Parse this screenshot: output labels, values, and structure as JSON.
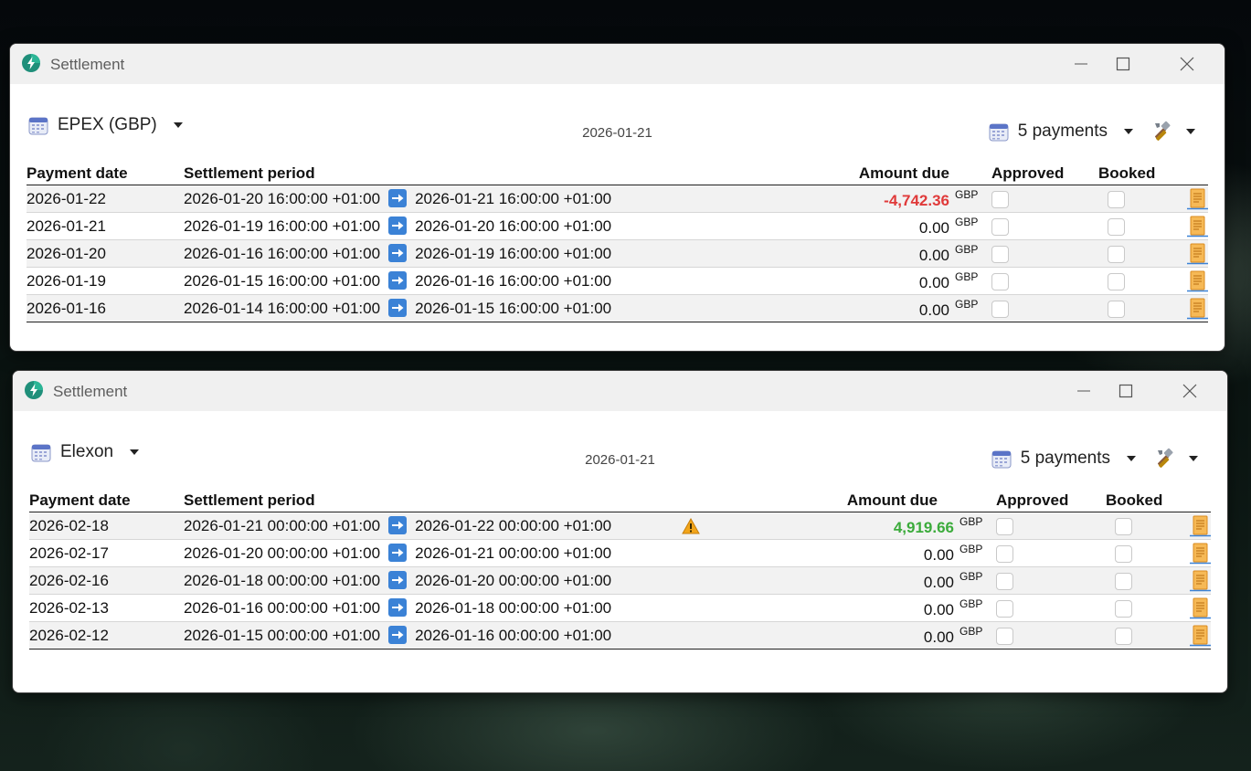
{
  "windows": [
    {
      "title": "Settlement",
      "source_label": "EPEX (GBP)",
      "date": "2026-01-21",
      "payments_label": "5 payments",
      "columns": {
        "payment_date": "Payment date",
        "settlement_period": "Settlement period",
        "amount_due": "Amount due",
        "approved": "Approved",
        "booked": "Booked"
      },
      "rows": [
        {
          "payment_date": "2026-01-22",
          "period_start": "2026-01-20 16:00:00 +01:00",
          "period_end": "2026-01-21 16:00:00 +01:00",
          "amount": "-4,742.36",
          "currency": "GBP",
          "amount_style": "neg",
          "warning": false
        },
        {
          "payment_date": "2026-01-21",
          "period_start": "2026-01-19 16:00:00 +01:00",
          "period_end": "2026-01-20 16:00:00 +01:00",
          "amount": "0.00",
          "currency": "GBP",
          "amount_style": "",
          "warning": false
        },
        {
          "payment_date": "2026-01-20",
          "period_start": "2026-01-16 16:00:00 +01:00",
          "period_end": "2026-01-19 16:00:00 +01:00",
          "amount": "0.00",
          "currency": "GBP",
          "amount_style": "",
          "warning": false
        },
        {
          "payment_date": "2026-01-19",
          "period_start": "2026-01-15 16:00:00 +01:00",
          "period_end": "2026-01-16 16:00:00 +01:00",
          "amount": "0.00",
          "currency": "GBP",
          "amount_style": "",
          "warning": false
        },
        {
          "payment_date": "2026-01-16",
          "period_start": "2026-01-14 16:00:00 +01:00",
          "period_end": "2026-01-15 16:00:00 +01:00",
          "amount": "0.00",
          "currency": "GBP",
          "amount_style": "",
          "warning": false
        }
      ]
    },
    {
      "title": "Settlement",
      "source_label": "Elexon",
      "date": "2026-01-21",
      "payments_label": "5 payments",
      "columns": {
        "payment_date": "Payment date",
        "settlement_period": "Settlement period",
        "amount_due": "Amount due",
        "approved": "Approved",
        "booked": "Booked"
      },
      "rows": [
        {
          "payment_date": "2026-02-18",
          "period_start": "2026-01-21 00:00:00 +01:00",
          "period_end": "2026-01-22 00:00:00 +01:00",
          "amount": "4,919.66",
          "currency": "GBP",
          "amount_style": "pos",
          "warning": true
        },
        {
          "payment_date": "2026-02-17",
          "period_start": "2026-01-20 00:00:00 +01:00",
          "period_end": "2026-01-21 00:00:00 +01:00",
          "amount": "0.00",
          "currency": "GBP",
          "amount_style": "",
          "warning": false
        },
        {
          "payment_date": "2026-02-16",
          "period_start": "2026-01-18 00:00:00 +01:00",
          "period_end": "2026-01-20 00:00:00 +01:00",
          "amount": "0.00",
          "currency": "GBP",
          "amount_style": "",
          "warning": false
        },
        {
          "payment_date": "2026-02-13",
          "period_start": "2026-01-16 00:00:00 +01:00",
          "period_end": "2026-01-18 00:00:00 +01:00",
          "amount": "0.00",
          "currency": "GBP",
          "amount_style": "",
          "warning": false
        },
        {
          "payment_date": "2026-02-12",
          "period_start": "2026-01-15 00:00:00 +01:00",
          "period_end": "2026-01-16 00:00:00 +01:00",
          "amount": "0.00",
          "currency": "GBP",
          "amount_style": "",
          "warning": false
        }
      ]
    }
  ],
  "icons": {
    "app": "app-logo-icon",
    "calendar": "calendar-icon",
    "arrow": "right-arrow-icon",
    "tools": "tools-icon",
    "document": "document-icon",
    "warning": "warning-icon"
  },
  "colors": {
    "negative": "#e03a3a",
    "positive": "#3bab3b",
    "arrow_blue": "#3b82d6",
    "doc_orange": "#f0a63c"
  }
}
